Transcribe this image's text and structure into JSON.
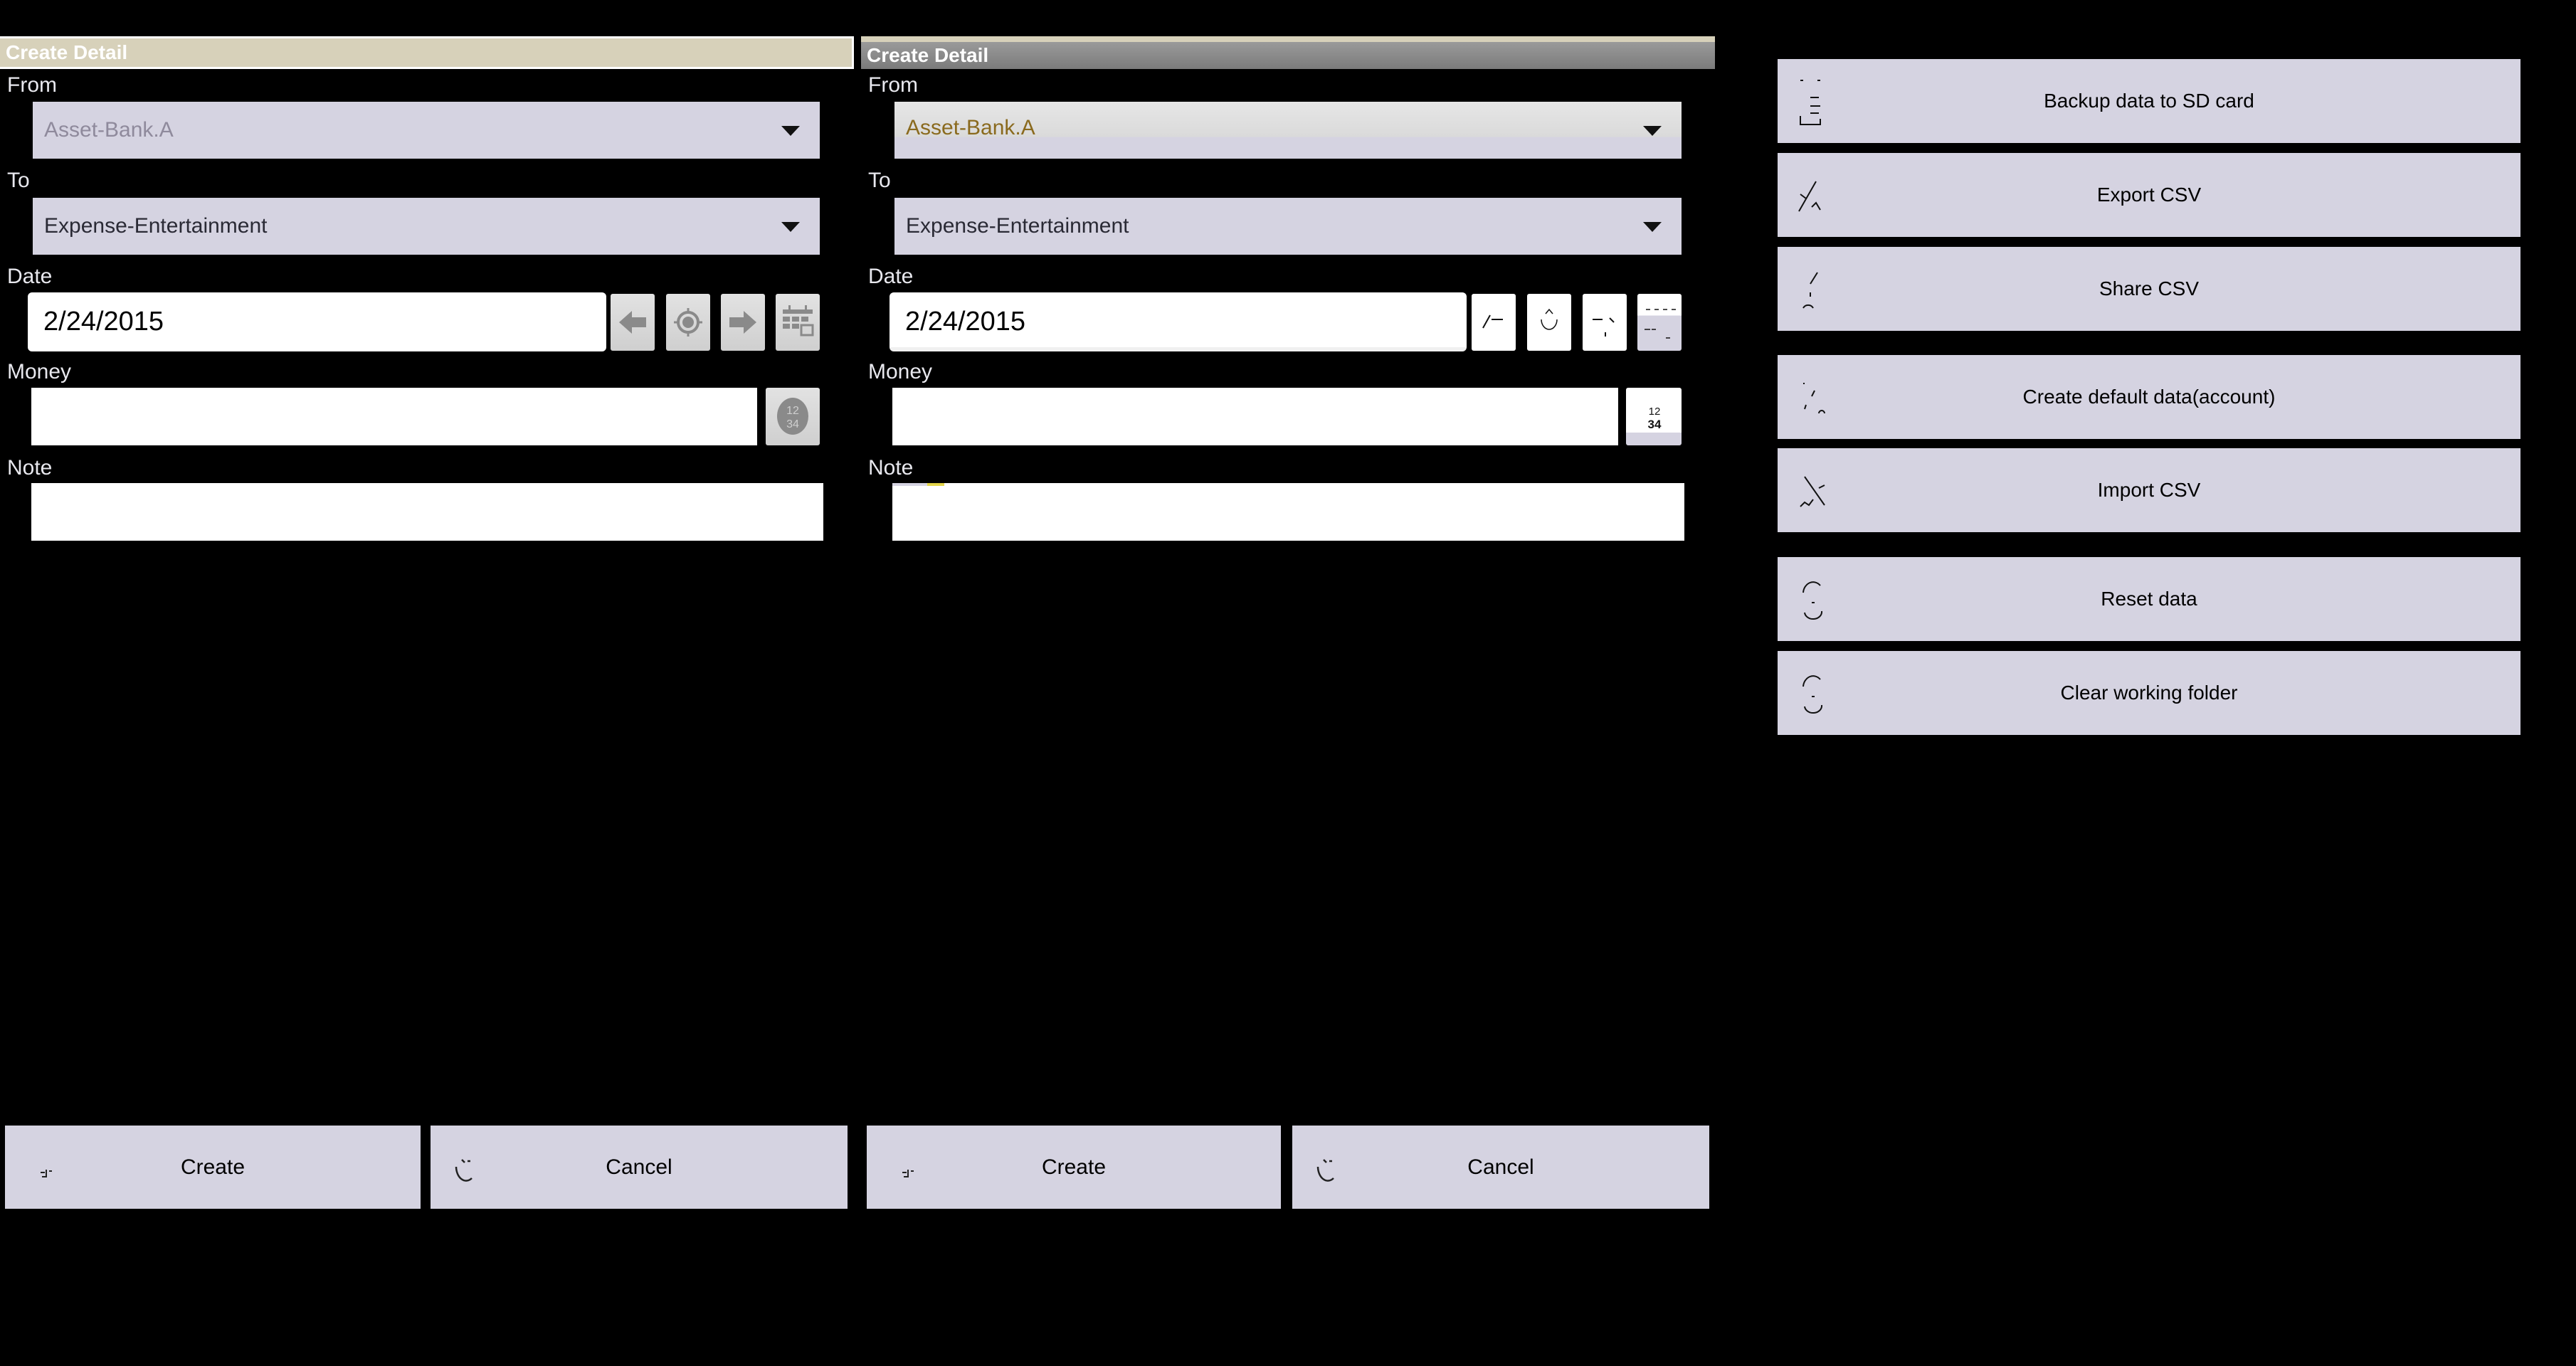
{
  "panels": [
    {
      "header": "Create Detail",
      "from_label": "From",
      "from_value": "Asset-Bank.A",
      "to_label": "To",
      "to_value": "Expense-Entertainment",
      "date_label": "Date",
      "date_value": "2/24/2015",
      "money_label": "Money",
      "money_value": "",
      "note_label": "Note",
      "note_value": "",
      "create_label": "Create",
      "cancel_label": "Cancel"
    },
    {
      "header": "Create Detail",
      "from_label": "From",
      "from_value": "Asset-Bank.A",
      "to_label": "To",
      "to_value": "Expense-Entertainment",
      "date_label": "Date",
      "date_value": "2/24/2015",
      "money_label": "Money",
      "money_value": "",
      "note_label": "Note",
      "note_value": "",
      "create_label": "Create",
      "cancel_label": "Cancel"
    }
  ],
  "date_nav_icons": [
    "arrow-left-icon",
    "locate-today-icon",
    "arrow-right-icon",
    "calendar-icon"
  ],
  "calculator_icon_text": "12/34",
  "side_menu": [
    {
      "label": "Backup data to SD card",
      "icon": "sd-card-icon"
    },
    {
      "label": "Export CSV",
      "icon": "export-icon"
    },
    {
      "label": "Share CSV",
      "icon": "share-icon"
    },
    {
      "label": "Create default data(account)",
      "icon": "create-icon"
    },
    {
      "label": "Import CSV",
      "icon": "import-icon"
    },
    {
      "label": "Reset data",
      "icon": "reset-icon"
    },
    {
      "label": "Clear working folder",
      "icon": "clear-icon"
    }
  ],
  "colors": {
    "header_left": "#d7d1ba",
    "header_right": "#8a8a8a",
    "control_bg": "#d5d3e1",
    "from_disabled_text": "#8f8a9c",
    "from_selected_text": "#8a6a1e",
    "focus_accent": "#e3d54a"
  }
}
